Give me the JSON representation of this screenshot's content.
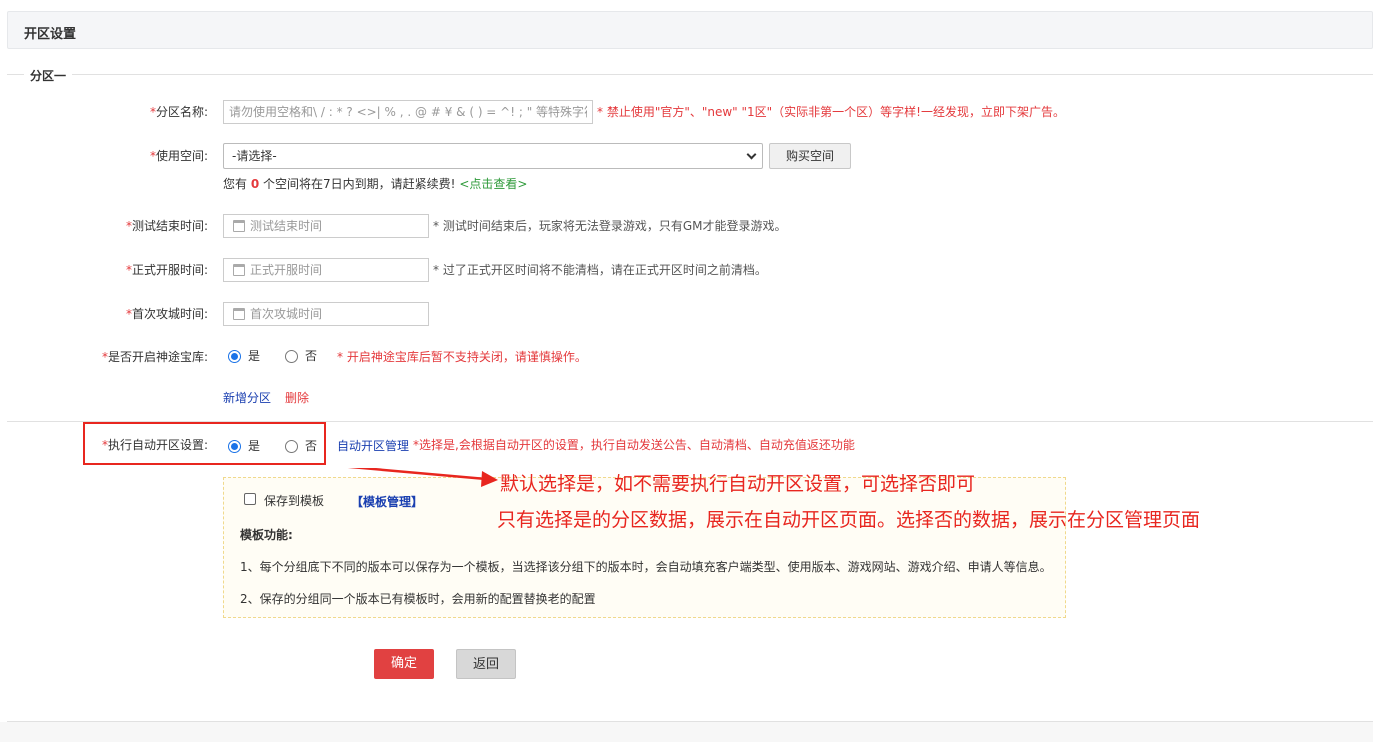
{
  "header": {
    "title": "开区设置"
  },
  "section": {
    "legend": "分区一"
  },
  "form": {
    "zone_name": {
      "required": "*",
      "label": "分区名称:",
      "placeholder": "请勿使用空格和\\ / : * ? <>| % , . @ # ¥ & ( ) = ^! ; \" 等特殊字符",
      "hint": "* 禁止使用\"官方\"、\"new\" \"1区\"（实际非第一个区）等字样!一经发现，立即下架广告。"
    },
    "space": {
      "required": "*",
      "label": "使用空间:",
      "selected": "-请选择-",
      "buy_button": "购买空间",
      "notice_prefix": "您有",
      "notice_count": "0",
      "notice_suffix": "个空间将在7日内到期，请赶紧续费!",
      "notice_link": "<点击查看>"
    },
    "test_end": {
      "required": "*",
      "label": "测试结束时间:",
      "placeholder": "测试结束时间",
      "hint": "* 测试时间结束后，玩家将无法登录游戏，只有GM才能登录游戏。"
    },
    "open_time": {
      "required": "*",
      "label": "正式开服时间:",
      "placeholder": "正式开服时间",
      "hint": "* 过了正式开区时间将不能清档，请在正式开区时间之前清档。"
    },
    "first_siege": {
      "required": "*",
      "label": "首次攻城时间:",
      "placeholder": "首次攻城时间"
    },
    "treasury": {
      "required": "*",
      "label": "是否开启神途宝库:",
      "yes": "是",
      "no": "否",
      "hint": "* 开启神途宝库后暂不支持关闭，请谨慎操作。"
    },
    "add_zone": "新增分区",
    "delete": "删除",
    "auto_open": {
      "required": "*",
      "label": "执行自动开区设置:",
      "yes": "是",
      "no": "否",
      "manage_link": "自动开区管理",
      "hint": "*选择是,会根据自动开区的设置，执行自动发送公告、自动清档、自动充值返还功能"
    }
  },
  "template": {
    "save_label": "保存到模板",
    "manage_link": "【模板管理】",
    "title": "模板功能:",
    "line1": "1、每个分组底下不同的版本可以保存为一个模板，当选择该分组下的版本时，会自动填充客户端类型、使用版本、游戏网站、游戏介绍、申请人等信息。",
    "line2": "2、保存的分组同一个版本已有模板时，会用新的配置替换老的配置"
  },
  "annotation": {
    "line1": "默认选择是，如不需要执行自动开区设置，可选择否即可",
    "line2": "只有选择是的分区数据，展示在自动开区页面。选择否的数据，展示在分区管理页面"
  },
  "actions": {
    "ok": "确定",
    "back": "返回"
  },
  "colors": {
    "accent_red": "#e4393c",
    "link_blue": "#1a3fb0",
    "radio_blue": "#1a73e8",
    "annotation_red": "#e8261f"
  }
}
